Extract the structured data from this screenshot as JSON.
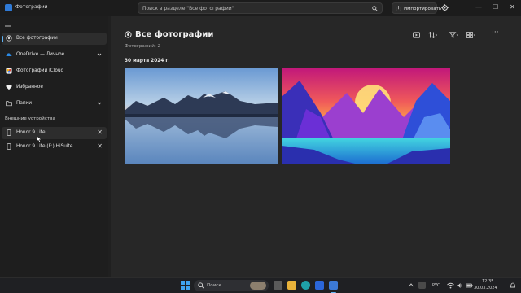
{
  "window": {
    "app_title": "Фотографии",
    "search_placeholder": "Поиск в разделе \"Все фотографии\"",
    "import_label": "Импортировать",
    "controls": {
      "minimize": "—",
      "maximize": "☐",
      "close": "✕"
    }
  },
  "sidebar": {
    "items": [
      {
        "label": "Все фотографии",
        "icon": "photos-icon",
        "active": true
      },
      {
        "label": "OneDrive — Личное",
        "icon": "onedrive-cloud-icon"
      },
      {
        "label": "Фотографии iCloud",
        "icon": "icloud-icon"
      },
      {
        "label": "Избранное",
        "icon": "heart-icon"
      },
      {
        "label": "Папки",
        "icon": "folder-icon"
      }
    ],
    "devices_section_label": "Внешние устройства",
    "devices": [
      {
        "label": "Honor 9 Lite",
        "icon": "phone-icon"
      },
      {
        "label": "Honor 9 Lite (F:) HiSuite",
        "icon": "phone-icon"
      }
    ],
    "remove_glyph": "✕"
  },
  "main": {
    "title": "Все фотографии",
    "subtitle": "Фотографий: 2",
    "date_group": "30 марта 2024 г.",
    "toolbar_more": "···",
    "photos": [
      {
        "name": "mountain-lake-photo",
        "kind": "photo"
      },
      {
        "name": "colorful-mountains-illustration",
        "kind": "illustration"
      }
    ]
  },
  "taskbar": {
    "search_label": "Поиск",
    "language": "РУС",
    "time": "12:35",
    "date": "30.03.2024"
  },
  "colors": {
    "accent": "#5fb2f2",
    "background": "#202020",
    "main_background": "#272727"
  }
}
